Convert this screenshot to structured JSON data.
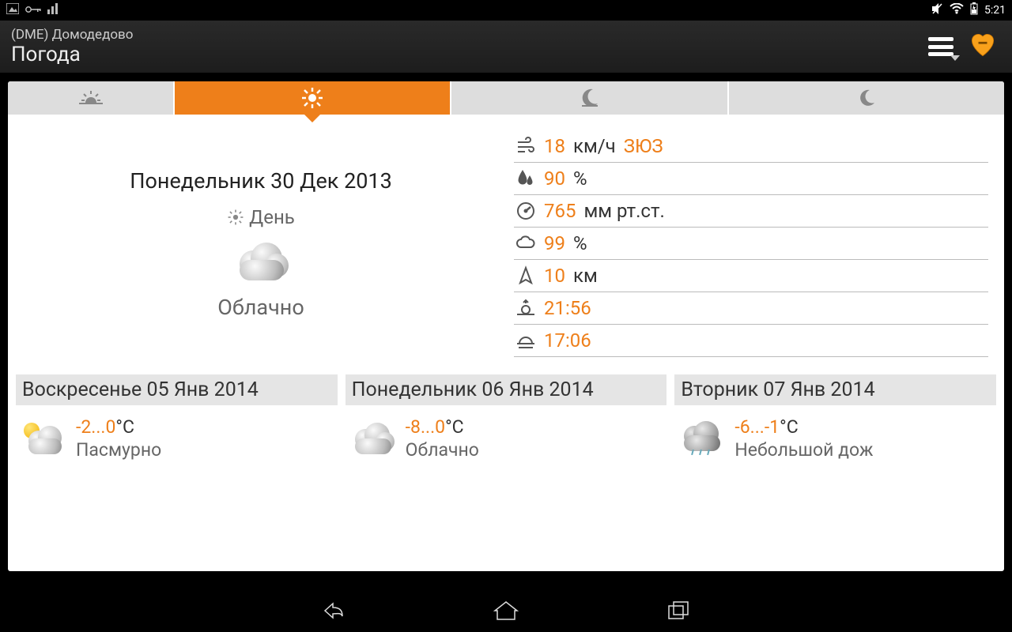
{
  "status": {
    "time": "5:21"
  },
  "header": {
    "subtitle": "(DME) Домодедово",
    "title": "Погода"
  },
  "current": {
    "date": "Понедельник 30 Дек 2013",
    "period": "День",
    "condition": "Облачно"
  },
  "details": {
    "wind_value": "18",
    "wind_unit": "км/ч",
    "wind_dir": "ЗЮЗ",
    "humidity_value": "90",
    "humidity_unit": "%",
    "pressure_value": "765",
    "pressure_unit": "мм рт.ст.",
    "cloud_value": "99",
    "cloud_unit": "%",
    "visibility_value": "10",
    "visibility_unit": "км",
    "sunrise": "21:56",
    "sunset": "17:06"
  },
  "forecast": [
    {
      "date": "Воскресенье 05 Янв 2014",
      "temp_range": "-2...0",
      "temp_unit": "°C",
      "condition": "Пасмурно"
    },
    {
      "date": "Понедельник 06 Янв 2014",
      "temp_range": "-8...0",
      "temp_unit": "°C",
      "condition": "Облачно"
    },
    {
      "date": "Вторник 07 Янв 2014",
      "temp_range": "-6...-1",
      "temp_unit": "°C",
      "condition": "Небольшой дож"
    }
  ]
}
